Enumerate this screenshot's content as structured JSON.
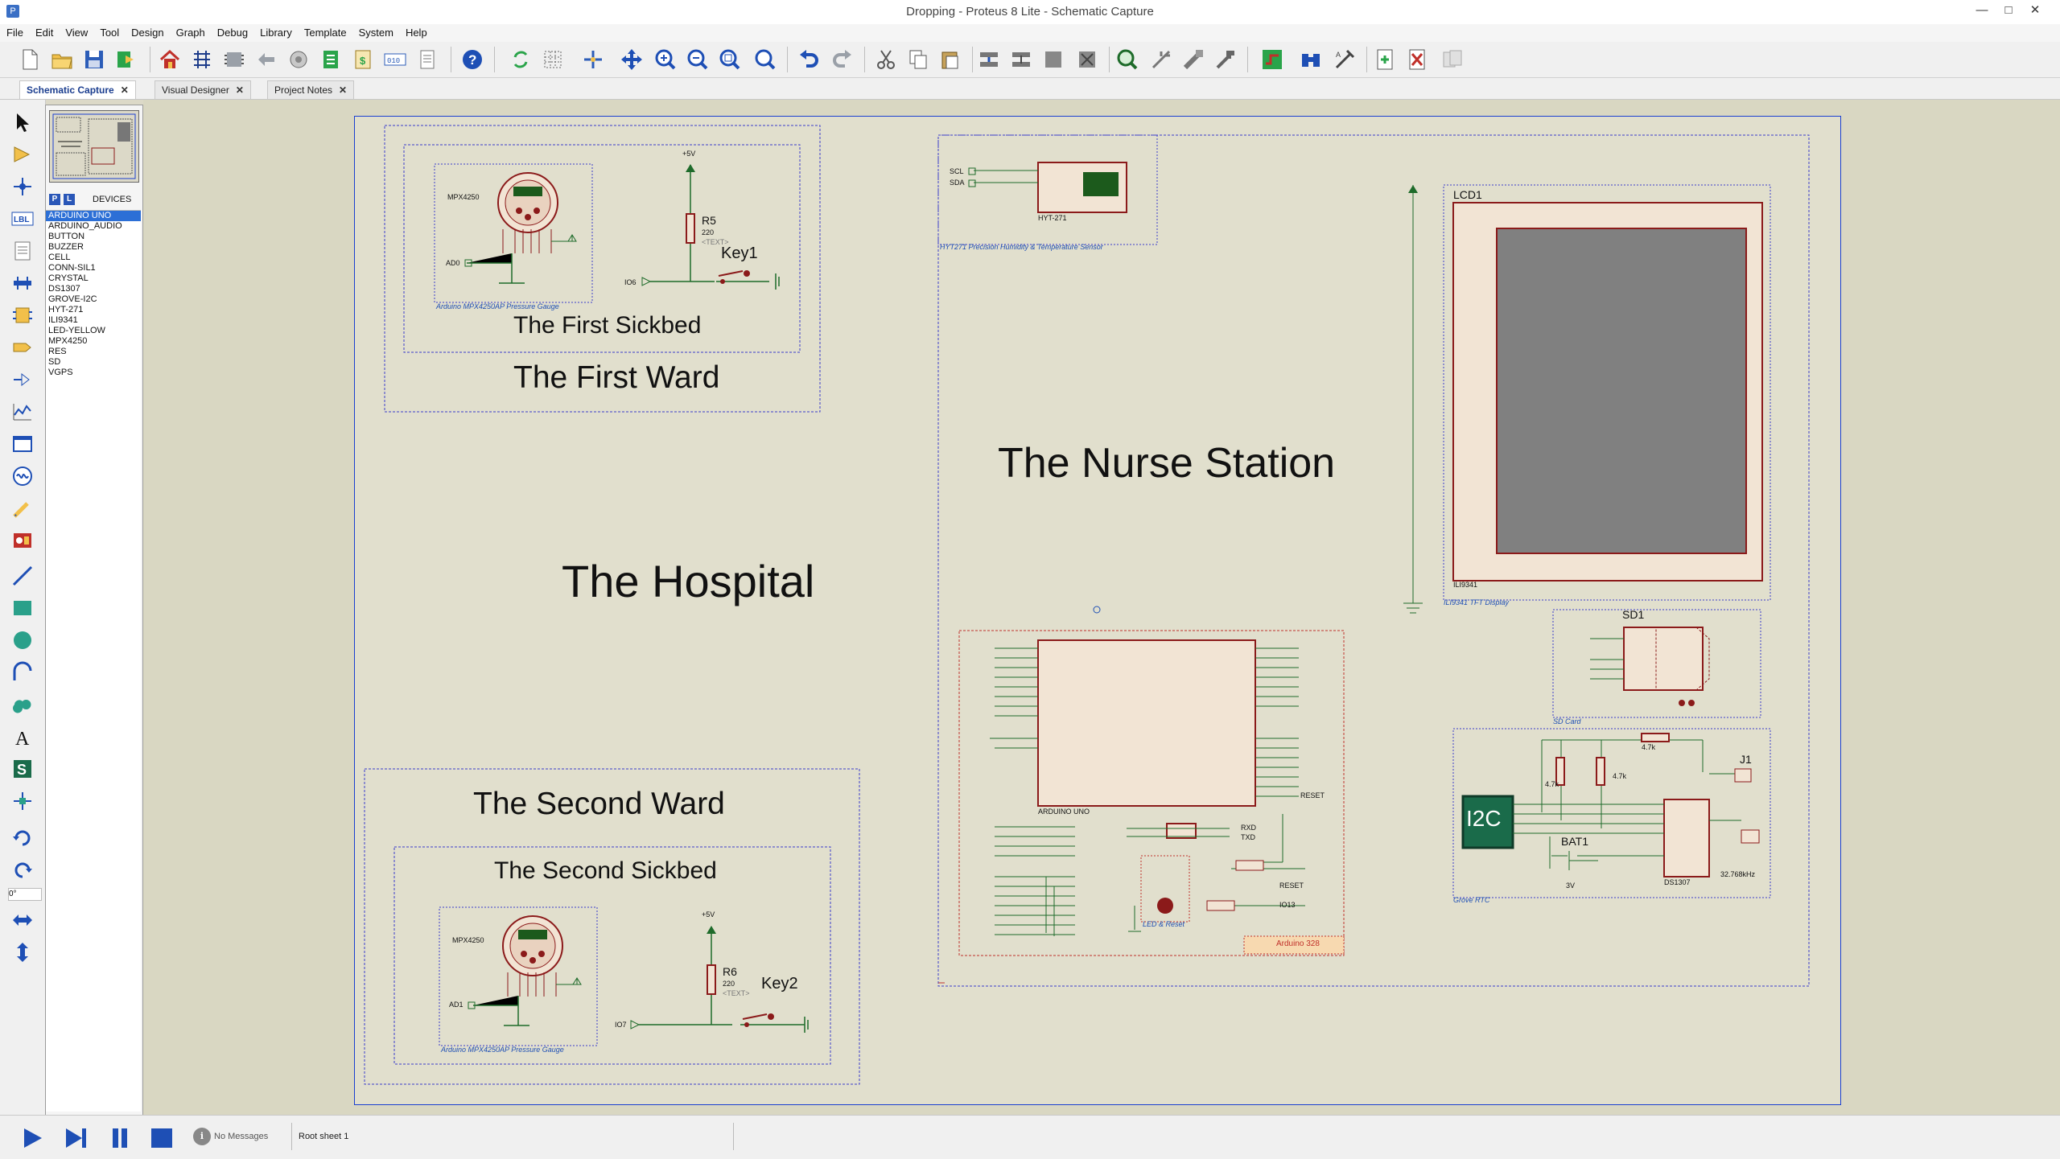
{
  "window": {
    "title": "Dropping - Proteus 8 Lite - Schematic Capture",
    "min": "—",
    "max": "□",
    "close": "✕"
  },
  "menu": [
    "File",
    "Edit",
    "View",
    "Tool",
    "Design",
    "Graph",
    "Debug",
    "Library",
    "Template",
    "System",
    "Help"
  ],
  "tabs": [
    {
      "label": "Schematic Capture",
      "active": true
    },
    {
      "label": "Visual Designer",
      "active": false
    },
    {
      "label": "Project Notes",
      "active": false
    }
  ],
  "devices": {
    "header_p": "P",
    "header_l": "L",
    "header_label": "DEVICES",
    "items": [
      "ARDUINO UNO",
      "ARDUINO_AUDIO",
      "BUTTON",
      "BUZZER",
      "CELL",
      "CONN-SIL1",
      "CRYSTAL",
      "DS1307",
      "GROVE-I2C",
      "HYT-271",
      "ILI9341",
      "LED-YELLOW",
      "MPX4250",
      "RES",
      "SD",
      "VGPS"
    ],
    "selected": 0
  },
  "rotation": "0°",
  "schematic": {
    "hospital": "The Hospital",
    "first_ward": "The First Ward",
    "first_sickbed": "The First Sickbed",
    "second_ward": "The Second Ward",
    "second_sickbed": "The Second Sickbed",
    "nurse_station": "The Nurse Station",
    "key1": "Key1",
    "key2": "Key2",
    "r5": "R5",
    "r6": "R6",
    "r220": "220",
    "text_ph": "<TEXT>",
    "plus5v": "+5V",
    "mpx": "MPX4250",
    "mpx_caption": "Arduino MPX4250AP Pressure Gauge",
    "ad0": "AD0",
    "ad1": "AD1",
    "io6": "IO6",
    "io7": "IO7",
    "hyt_caption": "HYT271 Precision Humidity & Temperature Sensor",
    "hyt_name": "HYT-271",
    "scl": "SCL",
    "sda": "SDA",
    "lcd1": "LCD1",
    "lcd_caption": "ILI9341 TFT Display",
    "lcd_part": "ILI9341",
    "sd1": "SD1",
    "sd_caption": "SD Card",
    "bat1": "BAT1",
    "bat_v": "3V",
    "j1": "J1",
    "i2c": "I2C",
    "ds1307": "DS1307",
    "crystal": "32.768kHz",
    "grove_caption": "Grove RTC",
    "arduino_name": "ARDUINO UNO",
    "arduino_tag": "Arduino 328",
    "reset": "RESET",
    "rxd": "RXD",
    "txd": "TXD",
    "led_reset": "LED & Reset",
    "io13": "IO13",
    "r47k": "4.7k"
  },
  "status": {
    "no_messages": "No Messages",
    "sheet": "Root sheet 1"
  }
}
